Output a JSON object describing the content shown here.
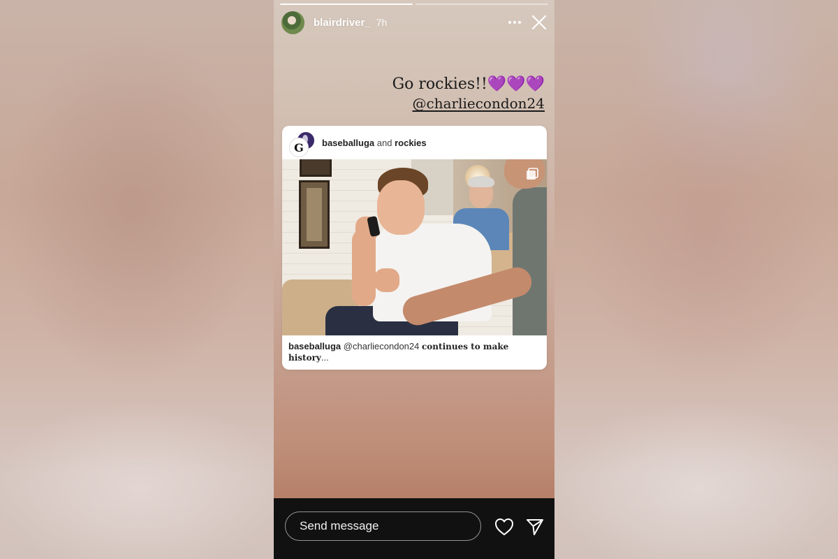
{
  "story": {
    "username": "blairdriver_",
    "time": "7h",
    "caption_line1": "Go rockies!!💜💜💜",
    "caption_line2": "@charliecondon24",
    "progress": {
      "segments": 2,
      "current": 1
    }
  },
  "post": {
    "account1": "baseballuga",
    "and_text": "and",
    "account2": "rockies",
    "caption_user": "baseballuga",
    "caption_mention": "@charliecondon24",
    "caption_text": "continues to make history",
    "caption_ellipsis": "..."
  },
  "reply_bar": {
    "placeholder": "Send message"
  },
  "icons": {
    "avatar": "user-avatar",
    "more": "more-options-icon",
    "close": "close-icon",
    "multi": "multiple-images-icon",
    "heart": "heart-icon",
    "send": "send-icon"
  },
  "colors": {
    "story_bg_top": "#d6c8bd",
    "story_bg_bottom": "#b47e66",
    "bar_bg": "#111111",
    "heart_emoji": "#9b3fd6"
  }
}
